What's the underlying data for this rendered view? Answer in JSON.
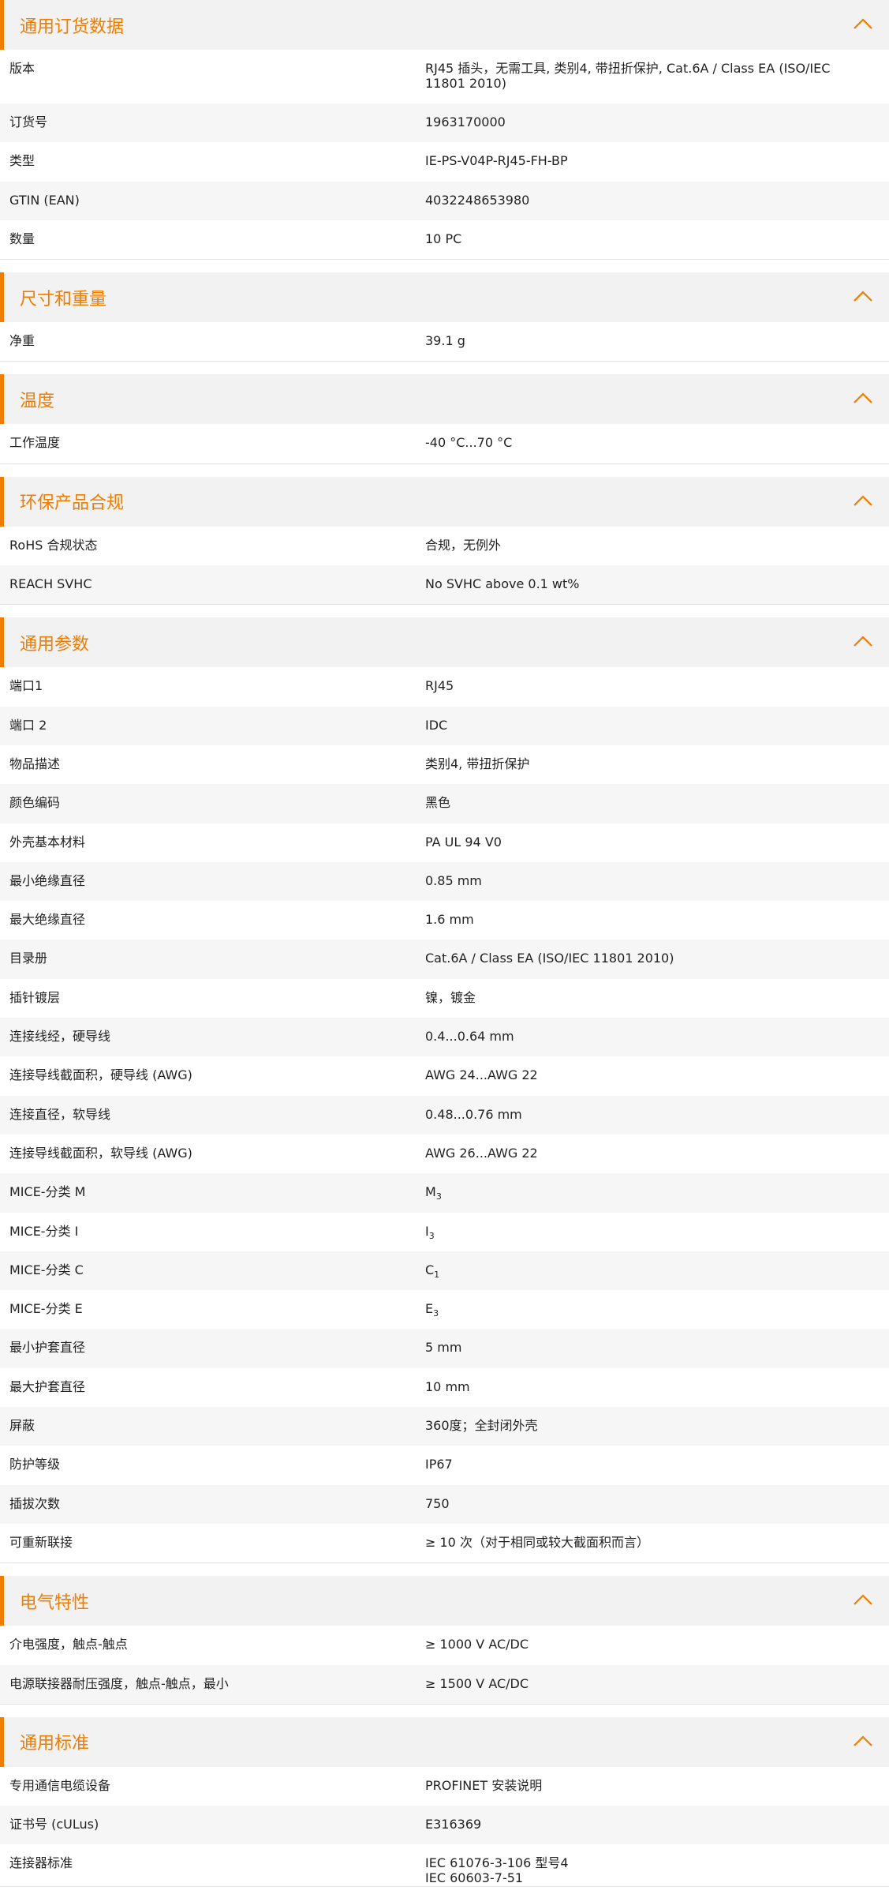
{
  "colors": {
    "accent": "#f07d00",
    "header_bg": "#f2f2f2",
    "row_alt_bg": "#f6f6f6"
  },
  "icons": {
    "collapse": "chevron-up-icon"
  },
  "sections": [
    {
      "title": "通用订货数据",
      "rows": [
        {
          "label": "版本",
          "value": "RJ45 插头，无需工具, 类别4, 带扭折保护, Cat.6A / Class EA (ISO/IEC 11801 2010)"
        },
        {
          "label": "订货号",
          "value": "1963170000"
        },
        {
          "label": "类型",
          "value": "IE-PS-V04P-RJ45-FH-BP"
        },
        {
          "label": "GTIN (EAN)",
          "value": "4032248653980"
        },
        {
          "label": "数量",
          "value": "10  PC"
        }
      ]
    },
    {
      "title": "尺寸和重量",
      "rows": [
        {
          "label": "净重",
          "value": "39.1  g"
        }
      ]
    },
    {
      "title": "温度",
      "rows": [
        {
          "label": "工作温度",
          "value": "-40 °C...70 °C"
        }
      ]
    },
    {
      "title": "环保产品合规",
      "rows": [
        {
          "label": "RoHS 合规状态",
          "value": "合规，无例外"
        },
        {
          "label": "REACH SVHC",
          "value": "No SVHC above 0.1 wt%"
        }
      ]
    },
    {
      "title": "通用参数",
      "rows": [
        {
          "label": "端口1",
          "value": "RJ45"
        },
        {
          "label": "端口 2",
          "value": "IDC"
        },
        {
          "label": "物品描述",
          "value": "类别4, 带扭折保护"
        },
        {
          "label": "颜色编码",
          "value": "黑色"
        },
        {
          "label": "外壳基本材料",
          "value": "PA UL 94 V0"
        },
        {
          "label": "最小绝缘直径",
          "value": "0.85  mm"
        },
        {
          "label": "最大绝缘直径",
          "value": "1.6  mm"
        },
        {
          "label": "目录册",
          "value": "Cat.6A / Class EA (ISO/IEC 11801 2010)"
        },
        {
          "label": "插针镀层",
          "value": "镍，镀金"
        },
        {
          "label": "连接线经，硬导线",
          "value": "0.4...0.64 mm"
        },
        {
          "label": "连接导线截面积，硬导线 (AWG)",
          "value": "AWG 24...AWG 22"
        },
        {
          "label": "连接直径，软导线",
          "value": "0.48...0.76 mm"
        },
        {
          "label": "连接导线截面积，软导线 (AWG)",
          "value": "AWG 26...AWG 22"
        },
        {
          "label": "MICE-分类 M",
          "value": "M",
          "sub": "3"
        },
        {
          "label": "MICE-分类 I",
          "value": "I",
          "sub": "3"
        },
        {
          "label": "MICE-分类 C",
          "value": "C",
          "sub": "1"
        },
        {
          "label": "MICE-分类 E",
          "value": "E",
          "sub": "3"
        },
        {
          "label": "最小护套直径",
          "value": "5  mm"
        },
        {
          "label": "最大护套直径",
          "value": "10  mm"
        },
        {
          "label": "屏蔽",
          "value": "360度；全封闭外壳"
        },
        {
          "label": "防护等级",
          "value": "IP67"
        },
        {
          "label": "插拔次数",
          "value": "750"
        },
        {
          "label": "可重新联接",
          "value": "≥ 10 次（对于相同或较大截面积而言）"
        }
      ]
    },
    {
      "title": "电气特性",
      "rows": [
        {
          "label": "介电强度，触点-触点",
          "value": "≥ 1000 V AC/DC"
        },
        {
          "label": "电源联接器耐压强度，触点-触点，最小",
          "value": "≥ 1500 V AC/DC"
        }
      ]
    },
    {
      "title": "通用标准",
      "rows": [
        {
          "label": "专用通信电缆设备",
          "value": "PROFINET 安装说明"
        },
        {
          "label": "证书号 (cULus)",
          "value": "E316369"
        },
        {
          "label": "连接器标准",
          "value": "IEC 61076-3-106 型号4",
          "value2": "IEC 60603-7-51"
        }
      ]
    }
  ]
}
